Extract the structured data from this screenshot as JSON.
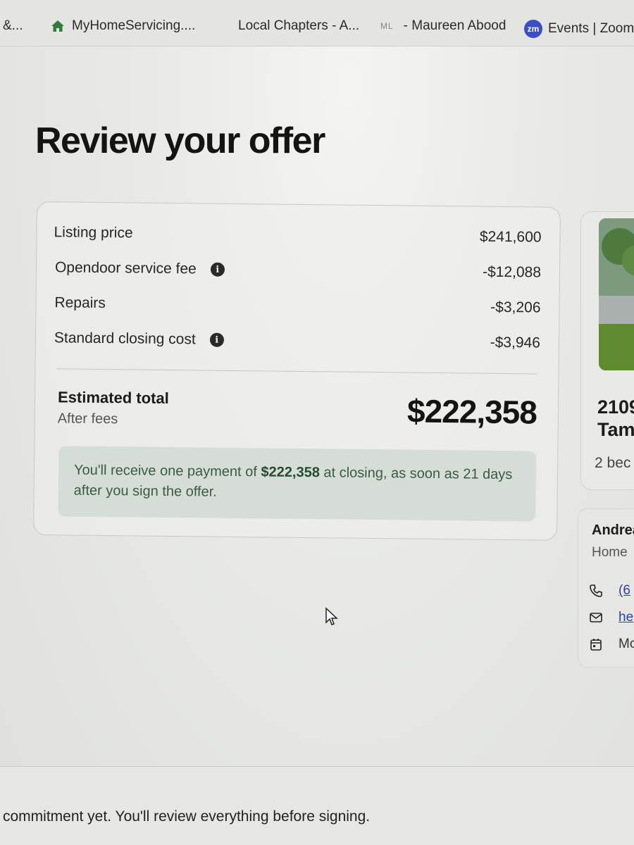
{
  "bookmarks": [
    {
      "label": "&...",
      "icon": "none"
    },
    {
      "label": "MyHomeServicing....",
      "icon": "home-icon"
    },
    {
      "label": "Local Chapters - A...",
      "icon": "none"
    },
    {
      "label": "- Maureen Abood",
      "icon": "ml-icon",
      "icon_text": "ML"
    },
    {
      "label": "Events | Zoom V",
      "icon": "zoom-icon",
      "icon_text": "zm"
    }
  ],
  "page": {
    "title": "Review your offer"
  },
  "offer": {
    "lines": [
      {
        "label": "Listing price",
        "amount": "$241,600",
        "info": false
      },
      {
        "label": "Opendoor service fee",
        "amount": "-$12,088",
        "info": true
      },
      {
        "label": "Repairs",
        "amount": "-$3,206",
        "info": false
      },
      {
        "label": "Standard closing cost",
        "amount": "-$3,946",
        "info": true
      }
    ],
    "total_label": "Estimated total",
    "total_sublabel": "After fees",
    "total_amount": "$222,358",
    "notice_prefix": "You'll receive one payment of ",
    "notice_amount": "$222,358",
    "notice_suffix": " at closing, as soon as 21 days after you sign the offer."
  },
  "property": {
    "address_line1": "2109",
    "address_line2": "Tam",
    "beds": "2 bec"
  },
  "agent": {
    "name": "Andrea",
    "role": "Home",
    "phone": "(6",
    "email": "he",
    "schedule": "Mc"
  },
  "footer": {
    "text": "commitment yet. You'll review everything before signing."
  },
  "colors": {
    "notice_bg": "#d6ddd6",
    "notice_text": "#3a5a48",
    "link": "#2b3fa8",
    "home_icon": "#2e7d3b",
    "zoom_icon": "#3b4fc4"
  }
}
